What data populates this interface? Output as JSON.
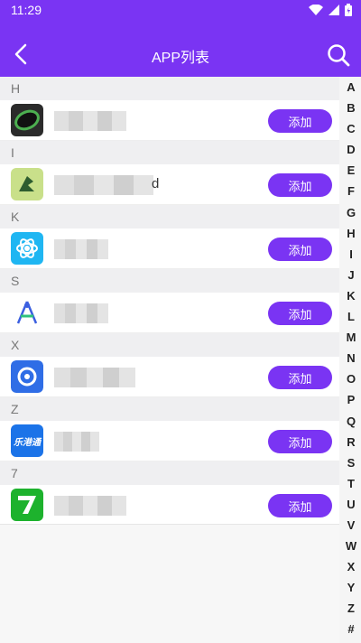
{
  "status": {
    "time": "11:29"
  },
  "toolbar": {
    "title": "APP列表"
  },
  "list": [
    {
      "section": "H",
      "button": "添加"
    },
    {
      "section": "I",
      "button": "添加",
      "name_tail": "d"
    },
    {
      "section": "K",
      "button": "添加"
    },
    {
      "section": "S",
      "button": "添加"
    },
    {
      "section": "X",
      "button": "添加"
    },
    {
      "section": "Z",
      "button": "添加",
      "icon_text": "乐港通"
    },
    {
      "section": "7",
      "button": "添加"
    }
  ],
  "index": [
    "A",
    "B",
    "C",
    "D",
    "E",
    "F",
    "G",
    "H",
    "I",
    "J",
    "K",
    "L",
    "M",
    "N",
    "O",
    "P",
    "Q",
    "R",
    "S",
    "T",
    "U",
    "V",
    "W",
    "X",
    "Y",
    "Z",
    "#"
  ],
  "colors": {
    "accent": "#7a34f3"
  }
}
